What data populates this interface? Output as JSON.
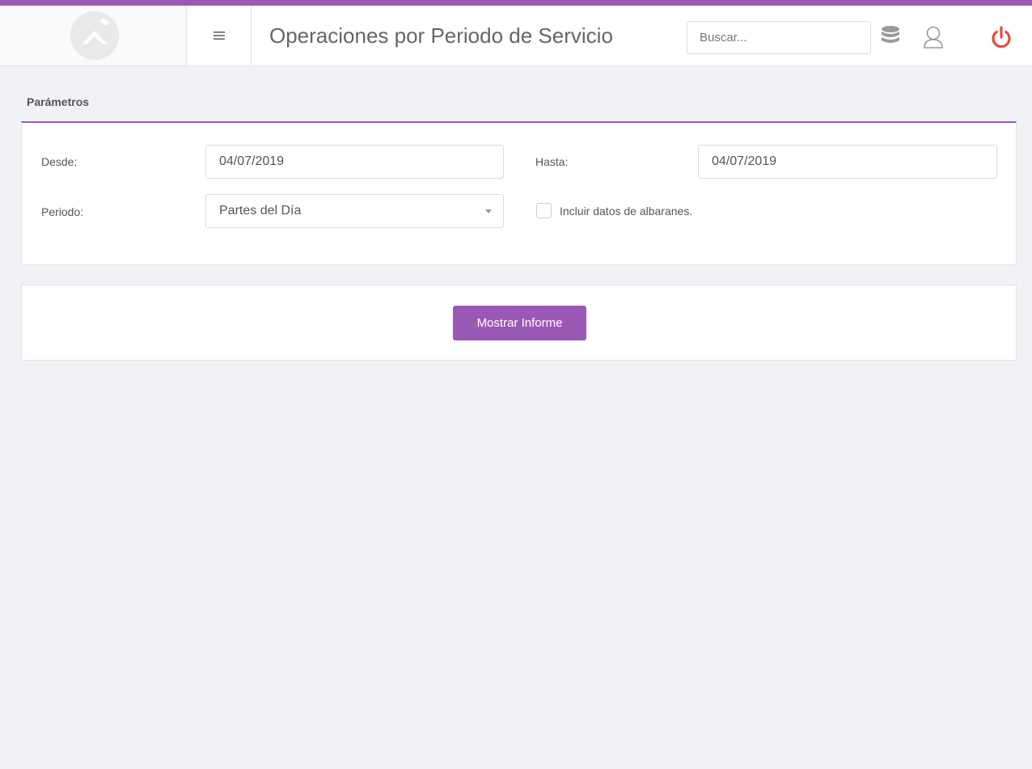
{
  "header": {
    "title": "Operaciones por Periodo de Servicio",
    "search": {
      "placeholder": "Buscar...",
      "value": ""
    },
    "icons": [
      "logo",
      "hamburger-menu-icon",
      "database-icon",
      "user-icon",
      "power-icon"
    ]
  },
  "colors": {
    "accent": "#9b59b6",
    "power": "#e74c3c",
    "background": "#f1f2f6"
  },
  "parameters": {
    "section_title": "Parámetros",
    "desde_label": "Desde:",
    "desde_value": "04/07/2019",
    "hasta_label": "Hasta:",
    "hasta_value": "04/07/2019",
    "periodo_label": "Periodo:",
    "periodo_value": "Partes del Día",
    "include_label": "Incluir datos de albaranes.",
    "include_checked": false
  },
  "actions": {
    "show_report_label": "Mostrar Informe"
  }
}
